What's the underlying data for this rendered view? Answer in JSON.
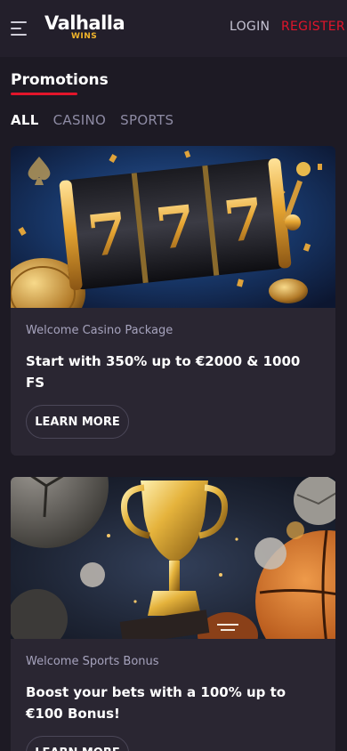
{
  "header": {
    "logo_main": "Valhalla",
    "logo_sub": "WINS",
    "login_label": "LOGIN",
    "register_label": "REGISTER"
  },
  "page": {
    "title": "Promotions"
  },
  "tabs": [
    {
      "label": "ALL",
      "active": true
    },
    {
      "label": "CASINO",
      "active": false
    },
    {
      "label": "SPORTS",
      "active": false
    }
  ],
  "promotions": [
    {
      "label": "Welcome Casino Package",
      "headline": "Start with 350% up to €2000 & 1000 FS",
      "button_label": "LEARN MORE",
      "image": "slot-machine-777"
    },
    {
      "label": "Welcome Sports Bonus",
      "headline": "Boost your bets with a 100% up to €100 Bonus!",
      "button_label": "LEARN MORE",
      "image": "gold-trophy-sports-balls"
    }
  ],
  "colors": {
    "background": "#1d1a24",
    "header": "#231f2b",
    "card": "#2a2632",
    "accent_red": "#e2152b",
    "logo_gold": "#f2b52b",
    "muted_text": "#a6a3bd"
  }
}
